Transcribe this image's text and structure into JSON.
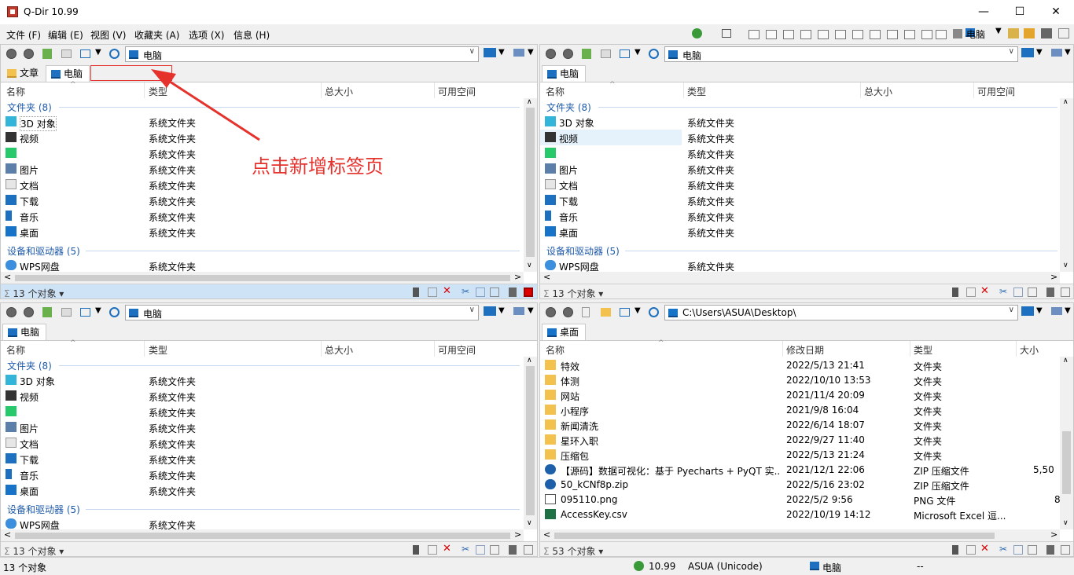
{
  "window": {
    "title": "Q-Dir 10.99",
    "minimize": "—",
    "maximize": "☐",
    "close": "✕"
  },
  "menu": [
    "文件 (F)",
    "编辑 (E)",
    "视图 (V)",
    "收藏夹 (A)",
    "选项 (X)",
    "信息 (H)"
  ],
  "toolbar_right": {
    "drive_label": "电脑"
  },
  "columns_pc": {
    "name": "名称",
    "type": "类型",
    "total": "总大小",
    "free": "可用空间"
  },
  "columns_desktop": {
    "name": "名称",
    "modified": "修改日期",
    "type": "类型",
    "size": "大小"
  },
  "pc_groups": {
    "folders": "文件夹 (8)",
    "devices": "设备和驱动器 (5)"
  },
  "pc_items": [
    {
      "name": "3D 对象",
      "type": "系统文件夹",
      "icon": "3d-objects-icon"
    },
    {
      "name": "视频",
      "type": "系统文件夹",
      "icon": "video-icon"
    },
    {
      "name": "",
      "type": "系统文件夹",
      "icon": "iqiyi-icon"
    },
    {
      "name": "图片",
      "type": "系统文件夹",
      "icon": "picture-icon"
    },
    {
      "name": "文档",
      "type": "系统文件夹",
      "icon": "document-icon"
    },
    {
      "name": "下载",
      "type": "系统文件夹",
      "icon": "download-icon"
    },
    {
      "name": "音乐",
      "type": "系统文件夹",
      "icon": "music-icon"
    },
    {
      "name": "桌面",
      "type": "系统文件夹",
      "icon": "desktop-icon"
    }
  ],
  "pc_device": {
    "name": "WPS网盘",
    "type": "系统文件夹"
  },
  "panes": {
    "top_left": {
      "address": "电脑",
      "tabs": [
        "文章",
        "电脑"
      ],
      "status": "13 个对象 ▾"
    },
    "top_right": {
      "address": "电脑",
      "tabs": [
        "电脑"
      ],
      "status": "13 个对象 ▾"
    },
    "bottom_left": {
      "address": "电脑",
      "tabs": [
        "电脑"
      ],
      "status": "13 个对象 ▾"
    },
    "bottom_right": {
      "address": "C:\\Users\\ASUA\\Desktop\\",
      "tabs": [
        "桌面"
      ],
      "status": "53 个对象 ▾"
    }
  },
  "desktop_items": [
    {
      "name": "特效",
      "modified": "2022/5/13 21:41",
      "type": "文件夹",
      "size": "",
      "icon": "folder-icon"
    },
    {
      "name": "体测",
      "modified": "2022/10/10 13:53",
      "type": "文件夹",
      "size": "",
      "icon": "folder-icon"
    },
    {
      "name": "网站",
      "modified": "2021/11/4 20:09",
      "type": "文件夹",
      "size": "",
      "icon": "folder-icon"
    },
    {
      "name": "小程序",
      "modified": "2021/9/8 16:04",
      "type": "文件夹",
      "size": "",
      "icon": "folder-icon"
    },
    {
      "name": "新闻清洗",
      "modified": "2022/6/14 18:07",
      "type": "文件夹",
      "size": "",
      "icon": "folder-icon"
    },
    {
      "name": "星环入职",
      "modified": "2022/9/27 11:40",
      "type": "文件夹",
      "size": "",
      "icon": "folder-icon"
    },
    {
      "name": "压缩包",
      "modified": "2022/5/13 21:24",
      "type": "文件夹",
      "size": "",
      "icon": "folder-icon"
    },
    {
      "name": "【源码】数据可视化：基于 Pyecharts + PyQT 实...",
      "modified": "2021/12/1 22:06",
      "type": "ZIP 压缩文件",
      "size": "5,50",
      "icon": "zip-icon"
    },
    {
      "name": "50_kCNf8p.zip",
      "modified": "2022/5/16 23:02",
      "type": "ZIP 压缩文件",
      "size": "",
      "icon": "zip-icon"
    },
    {
      "name": "095110.png",
      "modified": "2022/5/2 9:56",
      "type": "PNG 文件",
      "size": "8",
      "icon": "image-file-icon"
    },
    {
      "name": "AccessKey.csv",
      "modified": "2022/10/19 14:12",
      "type": "Microsoft Excel 逗...",
      "size": "",
      "icon": "excel-icon"
    }
  ],
  "bottom_status": {
    "count": "13 个对象",
    "version": "10.99",
    "user": "ASUA (Unicode)",
    "location": "电脑",
    "extra": "--"
  },
  "annotation": {
    "text": "点击新增标签页",
    "color": "#e5322d"
  }
}
